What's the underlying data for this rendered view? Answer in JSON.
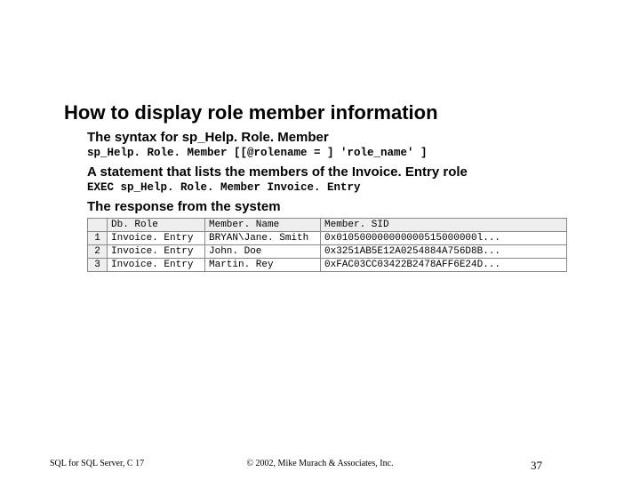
{
  "title": "How to display role member information",
  "sections": {
    "syntax_heading": "The syntax for sp_Help. Role. Member",
    "syntax_code": "sp_Help. Role. Member [[@rolename = ] 'role_name' ]",
    "example_heading": "A statement that lists the members of the Invoice. Entry role",
    "example_code": "EXEC sp_Help. Role. Member Invoice. Entry",
    "response_heading": "The response from the system"
  },
  "table": {
    "headers": {
      "col1": "Db. Role",
      "col2": "Member. Name",
      "col3": "Member. SID"
    },
    "rows": [
      {
        "n": "1",
        "role": "Invoice. Entry",
        "name": "BRYAN\\Jane. Smith",
        "sid": "0x010500000000000515000000l..."
      },
      {
        "n": "2",
        "role": "Invoice. Entry",
        "name": "John. Doe",
        "sid": "0x3251AB5E12A0254884A756D8B..."
      },
      {
        "n": "3",
        "role": "Invoice. Entry",
        "name": "Martin. Rey",
        "sid": "0xFAC03CC03422B2478AFF6E24D..."
      }
    ]
  },
  "footer": {
    "left": "SQL for SQL Server, C 17",
    "center": "© 2002, Mike Murach & Associates, Inc.",
    "right": "37"
  }
}
